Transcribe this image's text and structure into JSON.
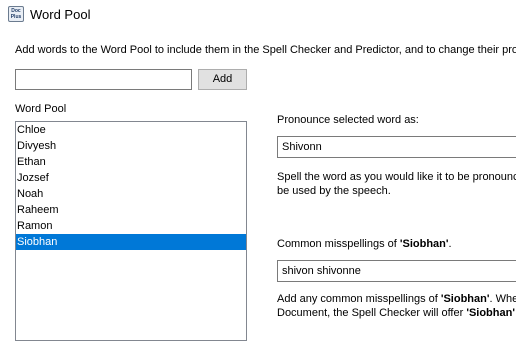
{
  "window": {
    "title": "Word Pool",
    "icon": "app-icon",
    "icon_text": "Doc Plus"
  },
  "intro": "Add words to the Word Pool to include them in the Spell Checker and Predictor, and to change their pron",
  "add": {
    "value": "",
    "button_label": "Add"
  },
  "pool": {
    "label": "Word Pool",
    "items": [
      {
        "label": "Chloe",
        "selected": false
      },
      {
        "label": "Divyesh",
        "selected": false
      },
      {
        "label": "Ethan",
        "selected": false
      },
      {
        "label": "Jozsef",
        "selected": false
      },
      {
        "label": "Noah",
        "selected": false
      },
      {
        "label": "Raheem",
        "selected": false
      },
      {
        "label": "Ramon",
        "selected": false
      },
      {
        "label": "Siobhan",
        "selected": true
      }
    ]
  },
  "pronounce": {
    "label": "Pronounce selected word as:",
    "value": "Shivonn",
    "help_line1": "Spell the word as you would like it to be pronounce",
    "help_line2": "be used by the speech."
  },
  "misspellings": {
    "label_prefix": "Common misspellings of ",
    "word": "'Siobhan'",
    "label_suffix": ".",
    "value": "shivon shivonne",
    "help1_prefix": "Add any common misspellings of ",
    "help1_word": "'Siobhan'",
    "help1_suffix": ". Wher",
    "help2_prefix": "Document, the Spell Checker will offer ",
    "help2_word": "'Siobhan'"
  },
  "colors": {
    "selection": "#0078d7",
    "background": "#ffffff",
    "button": "#e1e1e1"
  }
}
